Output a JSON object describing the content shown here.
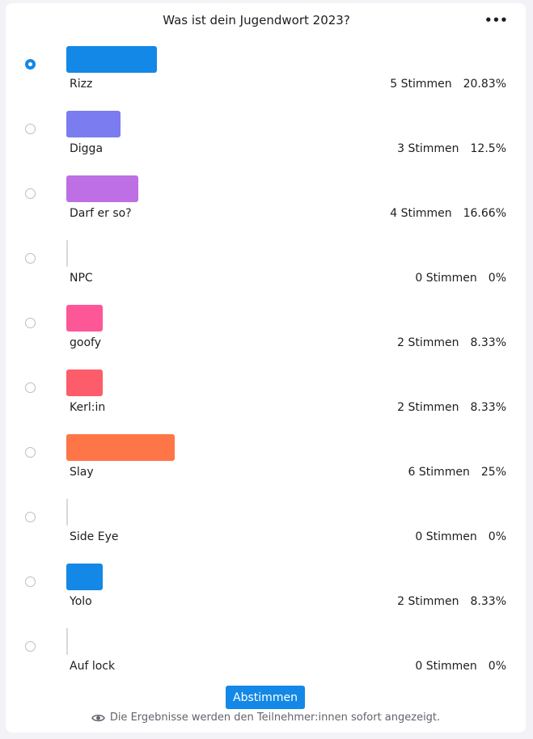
{
  "poll": {
    "title": "Was ist dein Jugendwort 2023?",
    "more_label": "•••",
    "options": [
      {
        "label": "Rizz",
        "votes": "5 Stimmen",
        "percent": "20.83%",
        "share": 20.83,
        "color": "#1388e6",
        "selected": true
      },
      {
        "label": "Digga",
        "votes": "3 Stimmen",
        "percent": "12.5%",
        "share": 12.5,
        "color": "#7b7cef",
        "selected": false
      },
      {
        "label": "Darf er so?",
        "votes": "4 Stimmen",
        "percent": "16.66%",
        "share": 16.66,
        "color": "#bd6fe3",
        "selected": false
      },
      {
        "label": "NPC",
        "votes": "0 Stimmen",
        "percent": "0%",
        "share": 0,
        "color": "#d8d8de",
        "selected": false
      },
      {
        "label": "goofy",
        "votes": "2 Stimmen",
        "percent": "8.33%",
        "share": 8.33,
        "color": "#fd5798",
        "selected": false
      },
      {
        "label": "Kerl:in",
        "votes": "2 Stimmen",
        "percent": "8.33%",
        "share": 8.33,
        "color": "#fd5c6b",
        "selected": false
      },
      {
        "label": "Slay",
        "votes": "6 Stimmen",
        "percent": "25%",
        "share": 25,
        "color": "#fe7548",
        "selected": false
      },
      {
        "label": "Side Eye",
        "votes": "0 Stimmen",
        "percent": "0%",
        "share": 0,
        "color": "#d8d8de",
        "selected": false
      },
      {
        "label": "Yolo",
        "votes": "2 Stimmen",
        "percent": "8.33%",
        "share": 8.33,
        "color": "#1388e6",
        "selected": false
      },
      {
        "label": "Auf lock",
        "votes": "0 Stimmen",
        "percent": "0%",
        "share": 0,
        "color": "#d8d8de",
        "selected": false
      }
    ],
    "submit_label": "Abstimmen",
    "notice": "Die Ergebnisse werden den Teilnehmer:innen sofort angezeigt.",
    "notice_icon": "eye-icon"
  }
}
